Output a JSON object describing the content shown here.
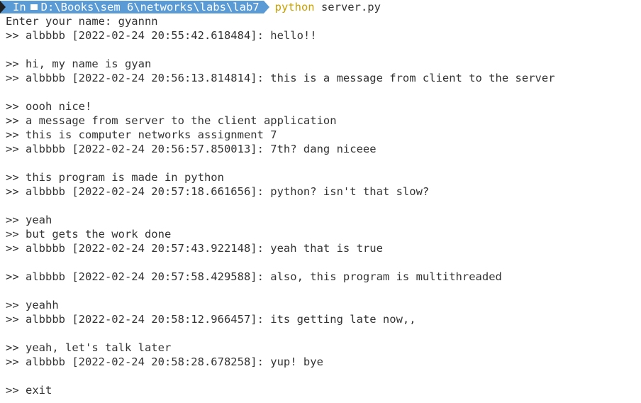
{
  "terminal": {
    "prompt": {
      "shell_label": "In",
      "folder_icon": "folder-icon",
      "path": "D:\\Books\\sem 6\\networks\\labs\\lab7",
      "command": "python",
      "argument": "server.py",
      "accent_color": "#5b9bd5",
      "command_color": "#c8a100"
    },
    "lines": [
      "Enter your name: gyannn",
      ">> albbbb [2022-02-24 20:55:42.618484]: hello!!",
      "",
      ">> hi, my name is gyan",
      ">> albbbb [2022-02-24 20:56:13.814814]: this is a message from client to the server",
      "",
      ">> oooh nice!",
      ">> a message from server to the client application",
      ">> this is computer networks assignment 7",
      ">> albbbb [2022-02-24 20:56:57.850013]: 7th? dang niceee",
      "",
      ">> this program is made in python",
      ">> albbbb [2022-02-24 20:57:18.661656]: python? isn't that slow?",
      "",
      ">> yeah",
      ">> but gets the work done",
      ">> albbbb [2022-02-24 20:57:43.922148]: yeah that is true",
      "",
      ">> albbbb [2022-02-24 20:57:58.429588]: also, this program is multithreaded",
      "",
      ">> yeahh",
      ">> albbbb [2022-02-24 20:58:12.966457]: its getting late now,,",
      "",
      ">> yeah, let's talk later",
      ">> albbbb [2022-02-24 20:58:28.678258]: yup! bye",
      "",
      ">> exit"
    ]
  }
}
